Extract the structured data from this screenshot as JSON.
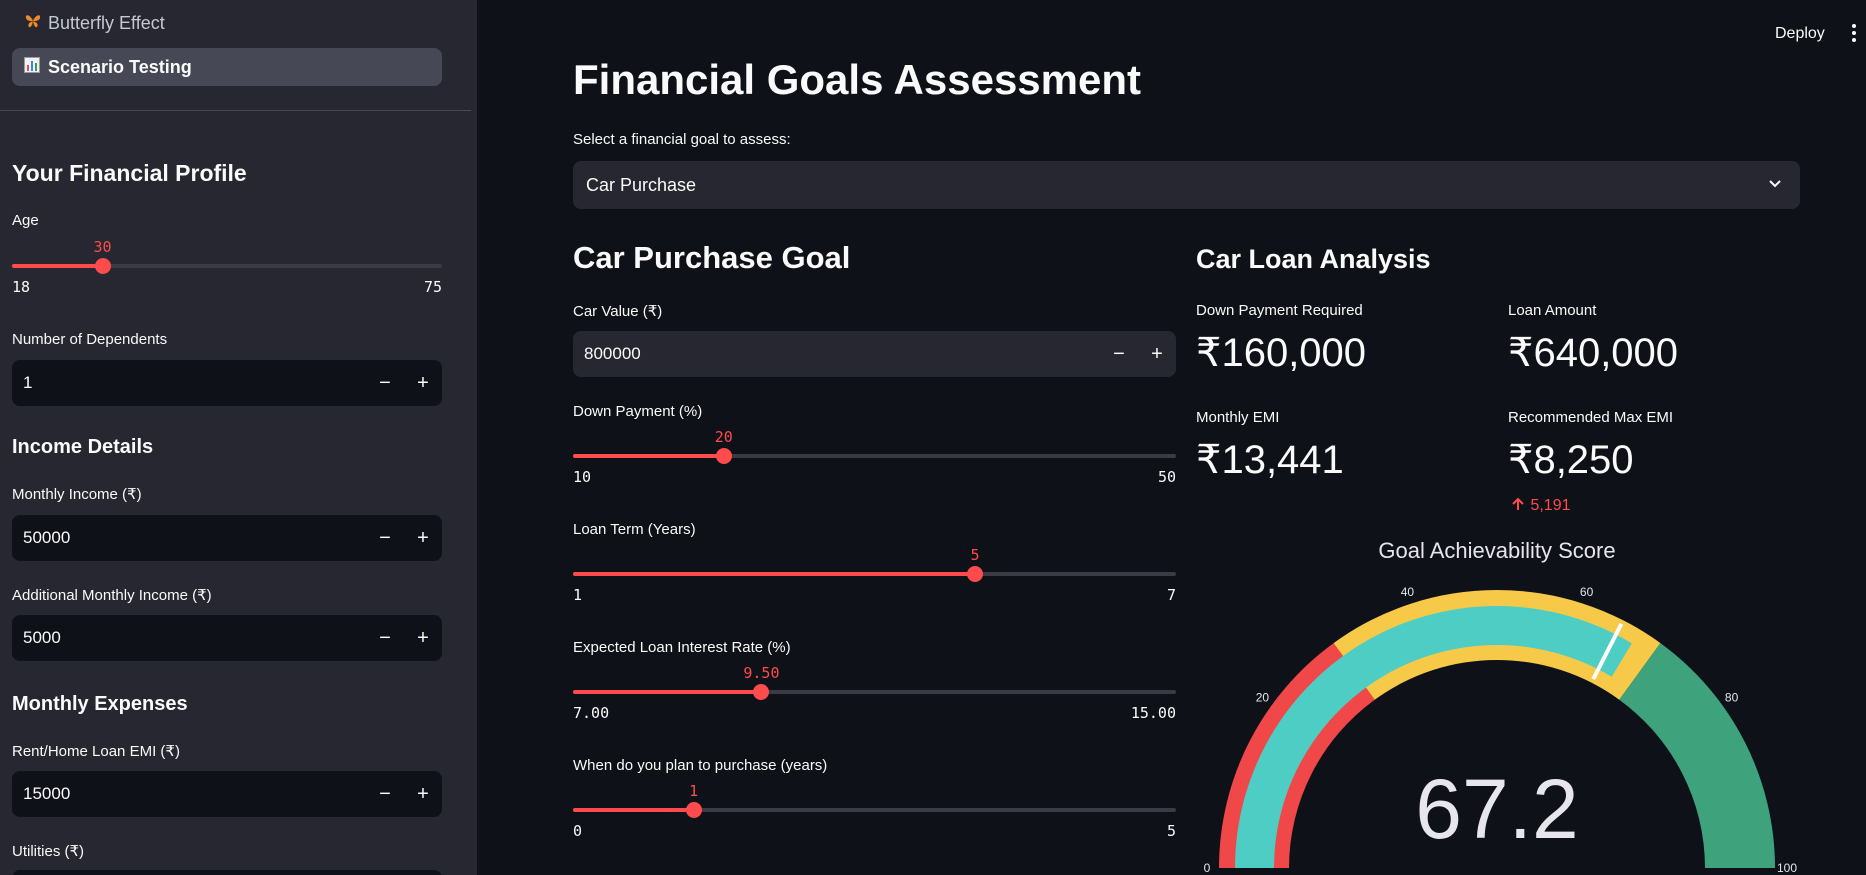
{
  "sidebar": {
    "nav": [
      {
        "label": "Butterfly Effect",
        "icon": "butterfly-icon",
        "active": false
      },
      {
        "label": "Scenario Testing",
        "icon": "bar-chart-icon",
        "active": true
      }
    ],
    "profile_heading": "Your Financial Profile",
    "age": {
      "label": "Age",
      "value": "30",
      "min": "18",
      "max": "75",
      "fraction": 0.2105
    },
    "dependents": {
      "label": "Number of Dependents",
      "value": "1"
    },
    "income_heading": "Income Details",
    "monthly_income": {
      "label": "Monthly Income (₹)",
      "value": "50000"
    },
    "additional_income": {
      "label": "Additional Monthly Income (₹)",
      "value": "5000"
    },
    "expenses_heading": "Monthly Expenses",
    "rent": {
      "label": "Rent/Home Loan EMI (₹)",
      "value": "15000"
    },
    "utilities": {
      "label": "Utilities (₹)"
    }
  },
  "header": {
    "deploy": "Deploy",
    "menu_icon": "vertical-dots-icon"
  },
  "main": {
    "title": "Financial Goals Assessment",
    "select_label": "Select a financial goal to assess:",
    "select_value": "Car Purchase",
    "goal_heading": "Car Purchase Goal",
    "car_value": {
      "label": "Car Value (₹)",
      "value": "800000"
    },
    "down_payment": {
      "label": "Down Payment (%)",
      "value": "20",
      "min": "10",
      "max": "50",
      "fraction": 0.25
    },
    "loan_term": {
      "label": "Loan Term (Years)",
      "value": "5",
      "min": "1",
      "max": "7",
      "fraction": 0.6667
    },
    "interest_rate": {
      "label": "Expected Loan Interest Rate (%)",
      "value": "9.50",
      "min": "7.00",
      "max": "15.00",
      "fraction": 0.3125
    },
    "purchase_years": {
      "label": "When do you plan to purchase (years)",
      "value": "1",
      "min": "0",
      "max": "5",
      "fraction": 0.2
    },
    "analysis_heading": "Car Loan Analysis",
    "metrics": {
      "down_payment": {
        "label": "Down Payment Required",
        "value": "₹160,000"
      },
      "loan_amount": {
        "label": "Loan Amount",
        "value": "₹640,000"
      },
      "monthly_emi": {
        "label": "Monthly EMI",
        "value": "₹13,441"
      },
      "max_emi": {
        "label": "Recommended Max EMI",
        "value": "₹8,250",
        "delta": "5,191"
      }
    }
  },
  "chart_data": {
    "type": "gauge",
    "title": "Goal Achievability Score",
    "value": 67.2,
    "value_label": "67.2",
    "range": [
      0,
      100
    ],
    "ticks": [
      "0",
      "20",
      "40",
      "60",
      "80",
      "100"
    ],
    "steps": [
      {
        "range": [
          0,
          30
        ],
        "color": "#f04848"
      },
      {
        "range": [
          30,
          70
        ],
        "color": "#f7c948"
      },
      {
        "range": [
          70,
          100
        ],
        "color": "#3ea37d"
      }
    ],
    "bar_color": "#4ecdc4",
    "threshold": 65
  },
  "colors": {
    "accent": "#ff4b4b",
    "sidebar_bg": "#262730",
    "main_bg": "#0e1117"
  }
}
